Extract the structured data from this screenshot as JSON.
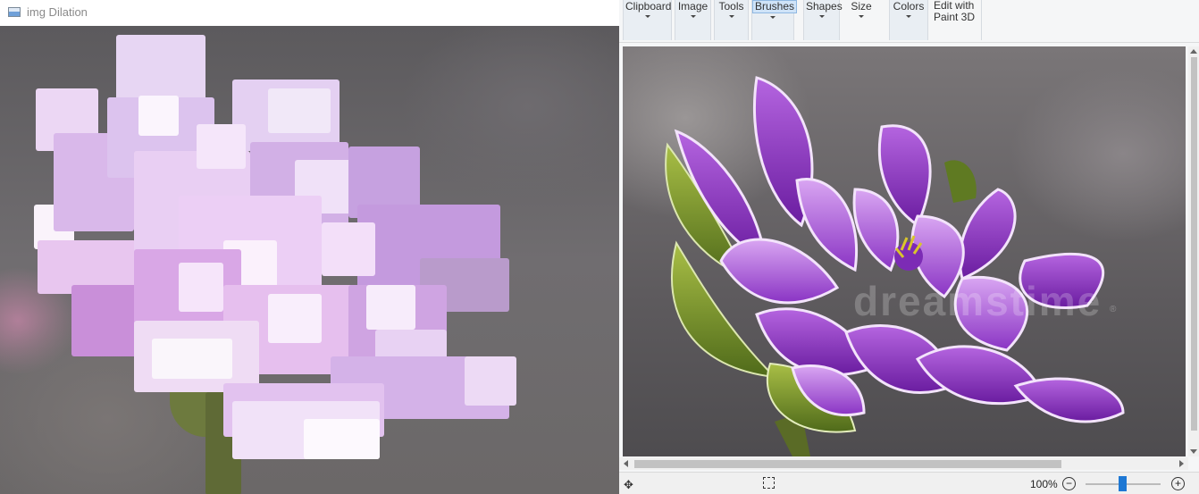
{
  "left_window": {
    "title": "img Dilation",
    "icon": "opencv-window-icon"
  },
  "paint": {
    "ribbon": {
      "groups": [
        {
          "label": "Clipboard",
          "has_dropdown": true
        },
        {
          "label": "Image",
          "has_dropdown": true
        },
        {
          "label": "Tools",
          "has_dropdown": true
        },
        {
          "label": "Brushes",
          "has_dropdown": true,
          "active": true
        },
        {
          "label": "Shapes",
          "has_dropdown": true
        },
        {
          "label": "Size",
          "has_dropdown": true
        },
        {
          "label": "Colors",
          "has_dropdown": true
        },
        {
          "label": "Edit with\nPaint 3D",
          "line1": "Edit with",
          "line2": "Paint 3D",
          "has_dropdown": false
        }
      ]
    },
    "watermark": "dreamstime",
    "statusbar": {
      "zoom_label": "100%",
      "zoom_out_symbol": "−",
      "zoom_in_symbol": "+",
      "zoom_level_fraction": 0.5
    }
  },
  "colors": {
    "accent": "#1e78d4",
    "petal_purple": "#8e2fc0",
    "petal_light": "#e6c8f2",
    "leaf_green": "#7f9a2c"
  }
}
